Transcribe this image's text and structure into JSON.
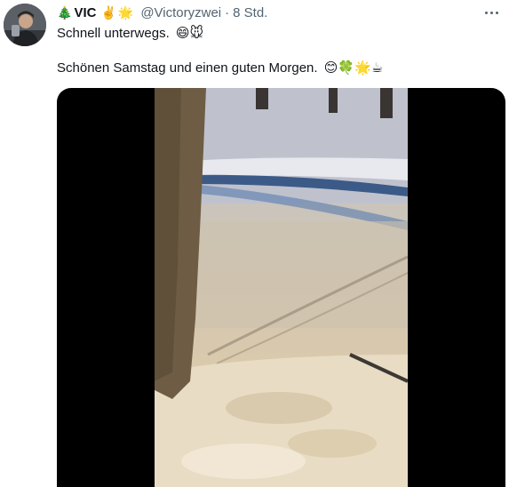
{
  "tweet": {
    "display_name": "VIC",
    "name_emojis": [
      "🎄",
      "✌️",
      "🌟"
    ],
    "handle": "@Victoryzwei",
    "separator": "·",
    "time": "8 Std.",
    "text_line1": "Schnell unterwegs.",
    "text_line1_emojis": "😄🐭",
    "text_line2": "Schönen Samstag und einen guten Morgen.",
    "text_line2_emojis": "😊🍀🌟☕"
  },
  "icons": {
    "more": "more-horizontal-icon",
    "avatar": "user-avatar"
  },
  "colors": {
    "primary_text": "#0f1419",
    "secondary_text": "#536471",
    "media_background": "#000000"
  }
}
